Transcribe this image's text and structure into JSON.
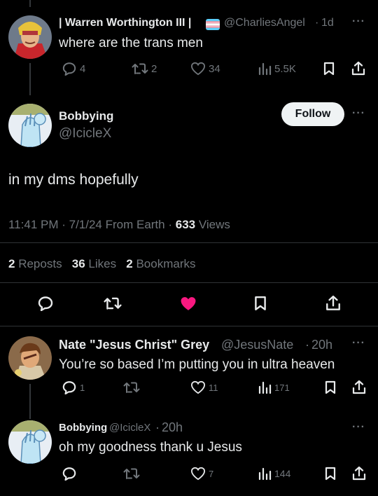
{
  "colors": {
    "bg": "#000000",
    "text": "#e7e9ea",
    "muted": "#71767b",
    "like": "#f91880",
    "divider": "#2f3336"
  },
  "tweet1": {
    "display_name": "| Warren Worthington III |",
    "handle": "@CharliesAngel",
    "time": "1d",
    "text": "where are the trans men",
    "replies": "4",
    "reposts": "2",
    "likes": "34",
    "views": "5.5K"
  },
  "main": {
    "display_name": "Bobbying",
    "handle": "@IcicleX",
    "follow_label": "Follow",
    "text": "in my dms hopefully",
    "meta": "11:41 PM · 7/1/24 From Earth · ",
    "views_count": "633",
    "views_label": "Views",
    "reposts_count": "2",
    "reposts_label": "Reposts",
    "likes_count": "36",
    "likes_label": "Likes",
    "bookmarks_count": "2",
    "bookmarks_label": "Bookmarks"
  },
  "reply1": {
    "display_name": "Nate \"Jesus Christ\" Grey",
    "handle": "@JesusNate",
    "time": "20h",
    "text": "You’re so based I’m putting you in ultra heaven",
    "replies": "1",
    "likes": "11",
    "views": "171"
  },
  "reply2": {
    "display_name": "Bobbying",
    "handle": "@IcicleX",
    "time": "20h",
    "text": "oh my goodness thank u Jesus",
    "likes": "7",
    "views": "144"
  },
  "icons": [
    "reply-icon",
    "repost-icon",
    "like-icon",
    "views-icon",
    "bookmark-icon",
    "share-icon",
    "more-icon",
    "trans-flag-icon"
  ]
}
